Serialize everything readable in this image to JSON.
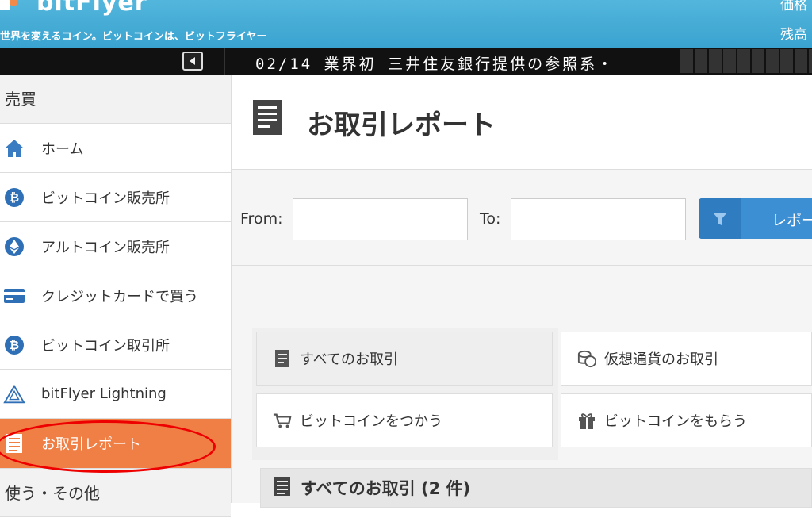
{
  "header": {
    "logo_text": "bitFlyer",
    "tagline": "世界を変えるコイン。ビットコインは、ビットフライヤー",
    "price_label": "価格",
    "balance_label": "残高"
  },
  "ticker": {
    "text": "02/14 業界初 三井住友銀行提供の参照系・"
  },
  "sidebar": {
    "section_trade": "売買",
    "items": [
      {
        "label": "ホーム",
        "icon": "home-icon"
      },
      {
        "label": "ビットコイン販売所",
        "icon": "bitcoin-icon"
      },
      {
        "label": "アルトコイン販売所",
        "icon": "ethereum-icon"
      },
      {
        "label": "クレジットカードで買う",
        "icon": "credit-card-icon"
      },
      {
        "label": "ビットコイン取引所",
        "icon": "bitcoin-icon"
      },
      {
        "label": "bitFlyer Lightning",
        "icon": "lightning-logo-icon"
      },
      {
        "label": "お取引レポート",
        "icon": "report-icon",
        "active": true
      }
    ],
    "section_other": "使う・その他"
  },
  "main": {
    "title": "お取引レポート",
    "filter": {
      "from_label": "From:",
      "to_label": "To:",
      "from_value": "",
      "to_value": "",
      "button_label": "レポート"
    },
    "tiles": [
      {
        "label": "すべてのお取引",
        "icon": "document-icon",
        "selected": true
      },
      {
        "label": "仮想通貨のお取引",
        "icon": "coins-icon"
      },
      {
        "label": "ビットコインをつかう",
        "icon": "cart-icon"
      },
      {
        "label": "ビットコインをもらう",
        "icon": "gift-icon"
      }
    ],
    "list_header": "すべてのお取引 (2 件)"
  },
  "colors": {
    "header_blue": "#3aa3d0",
    "active_orange": "#f07f45",
    "button_blue": "#3d8fd4",
    "annotation_red": "#e00000"
  }
}
